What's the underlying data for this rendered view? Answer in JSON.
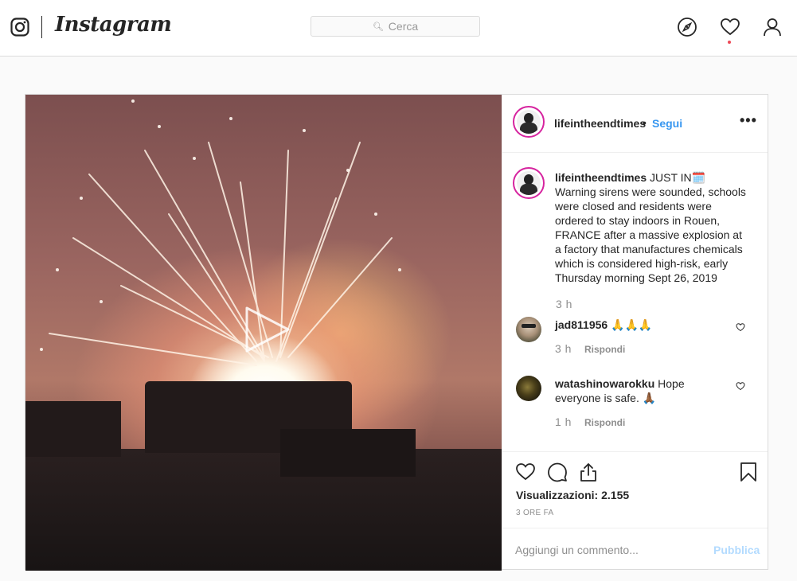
{
  "nav": {
    "wordmark": "Instagram",
    "search_placeholder": "Cerca",
    "icons": [
      "instagram-logo-icon",
      "explore-compass-icon",
      "heart-icon",
      "profile-icon"
    ],
    "notification_dot_color": "#ed4956"
  },
  "post": {
    "author": "lifeintheendtimes",
    "follow_separator": "•",
    "follow_label": "Segui",
    "more_label": "•••",
    "caption": {
      "username": "lifeintheendtimes",
      "text": " JUST IN🗓️ Warning sirens were sounded, schools were closed and residents were ordered to stay indoors in Rouen, FRANCE after a massive explosion at a factory that manufactures chemicals which is considered high-risk, early Thursday morning Sept 26, 2019",
      "time": "3 h"
    },
    "comments": [
      {
        "username": "jad811956",
        "text": " 🙏🙏🙏",
        "time": "3 h",
        "reply_label": "Rispondi"
      },
      {
        "username": "watashinowarokku",
        "text": " Hope everyone is safe. 🙏🏾",
        "time": "1 h",
        "reply_label": "Rispondi"
      }
    ],
    "views_label": "Visualizzazioni:",
    "views_count": "2.155",
    "date": "3 ORE FA",
    "add_comment_placeholder": "Aggiungi un commento...",
    "publish_label": "Pubblica"
  },
  "colors": {
    "link_blue": "#3897f0",
    "publish_disabled": "#b3dbff",
    "border": "#dbdbdb",
    "avatar_ring": "#d6249f"
  }
}
